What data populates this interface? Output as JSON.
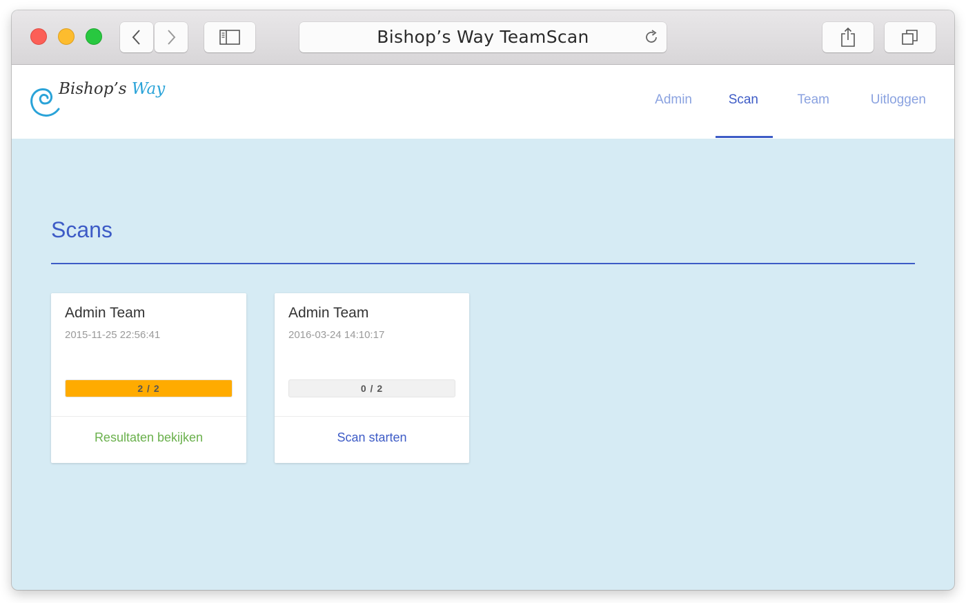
{
  "browser": {
    "title": "Bishop’s Way TeamScan",
    "icons": {
      "back": "chevron-left-icon",
      "forward": "chevron-right-icon",
      "sidebar": "sidebar-icon",
      "reload": "reload-icon",
      "share": "share-icon",
      "tabs": "tabs-icon"
    }
  },
  "logo": {
    "part1": "Bishop’s ",
    "part2": "Way"
  },
  "nav": {
    "items": [
      {
        "label": "Admin"
      },
      {
        "label": "Scan"
      },
      {
        "label": "Team"
      },
      {
        "label": "Uitloggen"
      }
    ],
    "active": "Scan"
  },
  "page": {
    "title": "Scans"
  },
  "cards": [
    {
      "team": "Admin Team",
      "date": "2015-11-25 22:56:41",
      "progress_label": "2 / 2",
      "progress_fraction": 1.0,
      "action": "Resultaten bekijken",
      "action_color": "#6ab04c"
    },
    {
      "team": "Admin Team",
      "date": "2016-03-24 14:10:17",
      "progress_label": "0 / 2",
      "progress_fraction": 0.0,
      "action": "Scan starten",
      "action_color": "#3d5bc6"
    }
  ],
  "colors": {
    "accent": "#3d5bc6",
    "nav_inactive": "#8aa2e0",
    "background": "#d6ebf4",
    "progress": "#ffab00",
    "success": "#6ab04c"
  }
}
